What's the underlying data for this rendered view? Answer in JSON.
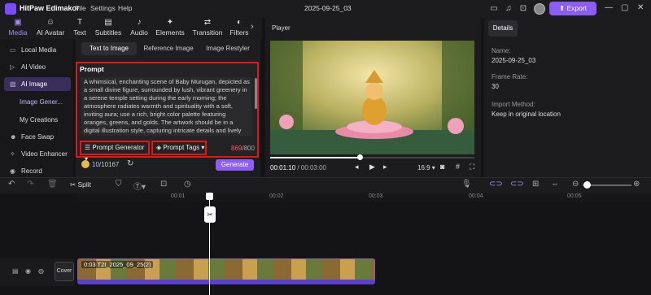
{
  "app": {
    "name": "HitPaw Edimakor",
    "menus": [
      "File",
      "Settings",
      "Help"
    ],
    "project_title": "2025-09-25_03",
    "export_label": "Export"
  },
  "toolbar": {
    "items": [
      {
        "label": "Media",
        "icon": "media-icon"
      },
      {
        "label": "AI Avatar",
        "icon": "ai-avatar-icon"
      },
      {
        "label": "Text",
        "icon": "text-icon"
      },
      {
        "label": "Subtitles",
        "icon": "subtitles-icon"
      },
      {
        "label": "Audio",
        "icon": "audio-icon"
      },
      {
        "label": "Elements",
        "icon": "elements-icon"
      },
      {
        "label": "Transition",
        "icon": "transition-icon"
      },
      {
        "label": "Filters",
        "icon": "filters-icon"
      }
    ]
  },
  "sidebar": {
    "items": [
      "Local Media",
      "AI Video",
      "AI Image",
      "Face Swap",
      "Video Enhancer",
      "Record"
    ],
    "subitems": [
      "Image Gener...",
      "My Creations"
    ]
  },
  "generator": {
    "tabs": [
      "Text to Image",
      "Reference Image",
      "Image Restyler"
    ],
    "prompt_label": "Prompt",
    "prompt_text": "A whimsical, enchanting scene of Baby Murugan, depicted as a small divine figure, surrounded by lush, vibrant greenery in a serene temple setting during the early morning; the atmosphere radiates warmth and spirituality with a soft, inviting aura; use a rich, bright color palette featuring oranges, greens, and golds. The artwork should be in a digital illustration style, capturing intricate details and lively expressions. The composition features a slightly low camera",
    "prompt_generator_label": "Prompt Generator",
    "prompt_tags_label": "Prompt Tags",
    "char_count": "869",
    "char_max": "/800",
    "credits_used": "10",
    "credits_total": "/10167",
    "generate_label": "Generate"
  },
  "player": {
    "label": "Player",
    "current_time": "00:01:10",
    "total_time": "/ 00:03:00",
    "aspect": "16:9",
    "progress": 0.44
  },
  "details": {
    "tab": "Details",
    "fields": [
      {
        "label": "Name:",
        "value": "2025-09-25_03"
      },
      {
        "label": "Frame Rate:",
        "value": "30"
      },
      {
        "label": "Import Method:",
        "value": "Keep in original location"
      }
    ]
  },
  "timeline": {
    "split_label": "Split",
    "ruler": [
      "00:01",
      "00:02",
      "00:03",
      "00:04",
      "00:05"
    ],
    "cover_label": "Cover",
    "clip_label": "0:03 T2I_2025_09_25(2)"
  },
  "colors": {
    "accent": "#8b5cf6",
    "highlight_border": "#e01818",
    "count_over": "#ff5c5c"
  }
}
